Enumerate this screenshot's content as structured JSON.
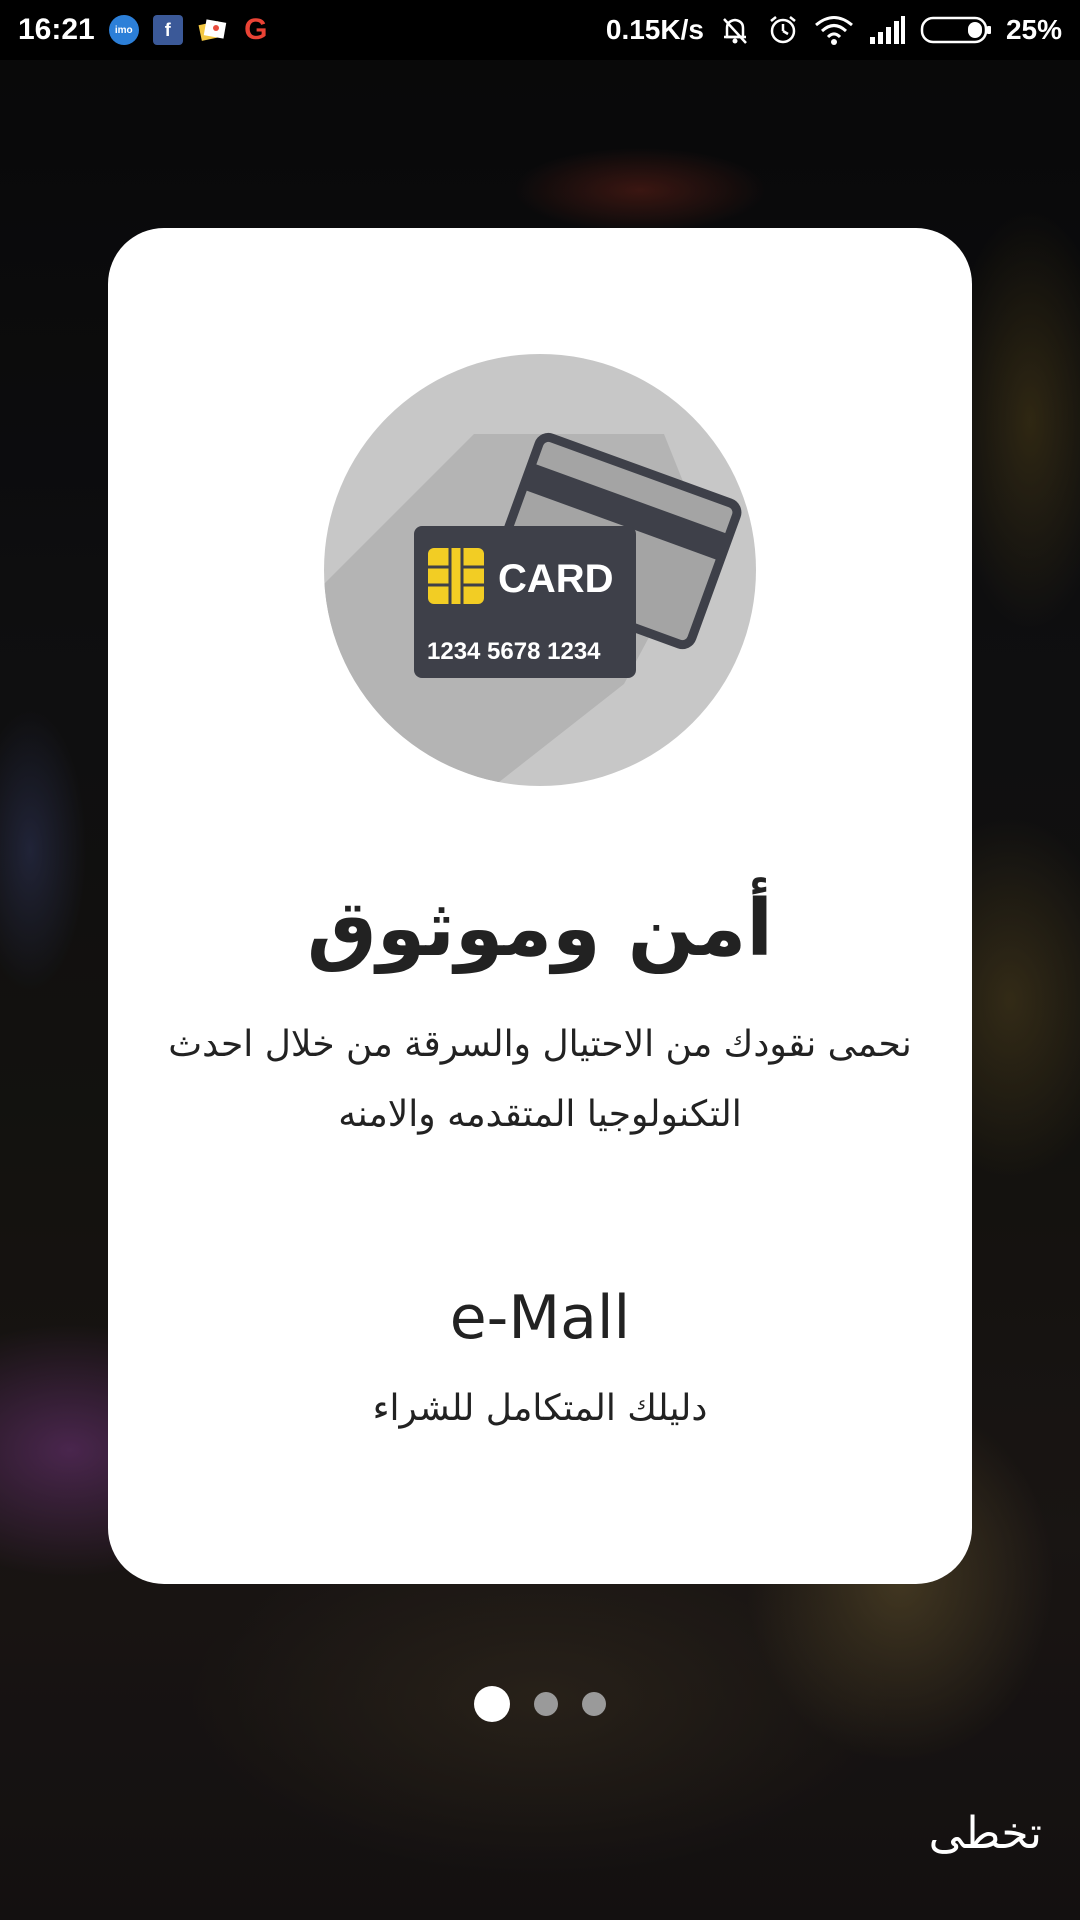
{
  "status_bar": {
    "time": "16:21",
    "network_speed": "0.15K/s",
    "battery_percent": "25%",
    "notification_icons": [
      "imo-icon",
      "facebook-icon",
      "gallery-icon",
      "google-icon"
    ],
    "battery_level": 0.25
  },
  "illustration": {
    "card_label": "CARD",
    "card_number": "1234 5678 1234",
    "chip_color": "#f2cd24",
    "card_color": "#3e4049",
    "circle_color": "#c7c7c7"
  },
  "onboarding": {
    "title": "أمن وموثوق",
    "description": "نحمى نقودك من الاحتيال والسرقة من خلال احدث التكنولوجيا المتقدمه والامنه",
    "brand": "e-Mall",
    "tagline": "دليلك المتكامل للشراء"
  },
  "pager": {
    "total_pages": 3,
    "current_page": 1
  },
  "skip_label": "تخطى"
}
